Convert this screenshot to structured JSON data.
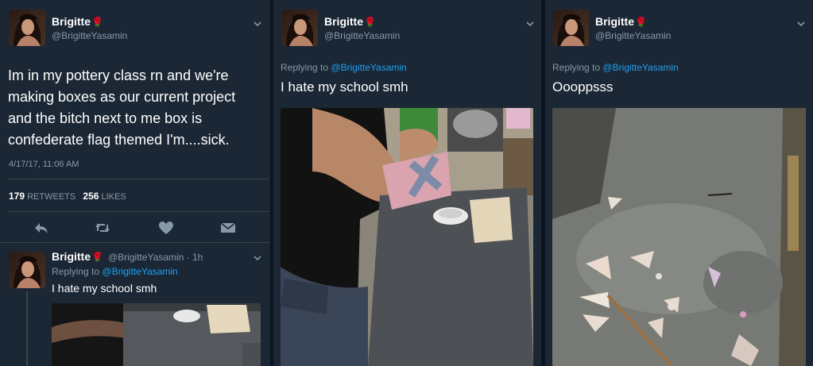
{
  "colors": {
    "background": "#1b2735",
    "gutter": "#0d141d",
    "text": "#ffffff",
    "muted": "#8899a6",
    "link": "#1da1f2",
    "rose": "#d0202a"
  },
  "user": {
    "name": "Brigitte",
    "emoji": "🌹",
    "handle": "@BrigitteYasamin"
  },
  "panel1": {
    "tweet": {
      "text_line1": "Im in my pottery class rn and we're",
      "text_line2": "making boxes as our current project",
      "text_line3": "and the bitch next to me box is",
      "text_line4": "confederate flag themed I'm....sick.",
      "timestamp": "4/17/17, 11:06 AM",
      "retweets_count": "179",
      "retweets_label": "RETWEETS",
      "likes_count": "256",
      "likes_label": "LIKES"
    },
    "actions": [
      "reply-icon",
      "retweet-icon",
      "like-icon",
      "message-icon"
    ],
    "reply": {
      "meta": "@BrigitteYasamin · 1h",
      "replying_prefix": "Replying to",
      "replying_to": "@BrigitteYasamin",
      "text": "I hate my school smh"
    }
  },
  "panel2": {
    "replying_prefix": "Replying to",
    "replying_to": "@BrigitteYasamin",
    "text": "I hate my school smh"
  },
  "panel3": {
    "replying_prefix": "Replying to",
    "replying_to": "@BrigitteYasamin",
    "text": "Oooppsss"
  }
}
